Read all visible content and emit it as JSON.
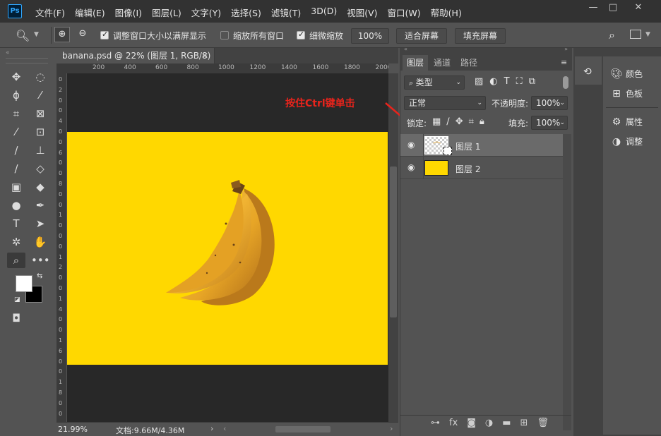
{
  "app": {
    "logo_text": "Ps"
  },
  "menu": [
    "文件(F)",
    "编辑(E)",
    "图像(I)",
    "图层(L)",
    "文字(Y)",
    "选择(S)",
    "滤镜(T)",
    "3D(D)",
    "视图(V)",
    "窗口(W)",
    "帮助(H)"
  ],
  "window_controls": {
    "minimize": "—",
    "maximize": "□",
    "close": "✕"
  },
  "options_bar": {
    "resize_windows_label": "调整窗口大小以满屏显示",
    "zoom_all_label": "缩放所有窗口",
    "scrubby_label": "细微缩放",
    "zoom_value": "100%",
    "fit_screen": "适合屏幕",
    "fill_screen": "填充屏幕"
  },
  "document": {
    "tab_title": "banana.psd @ 22% (图层 1, RGB/8)",
    "ruler_h": [
      "200",
      "400",
      "600",
      "800",
      "1000",
      "1200",
      "1400",
      "1600",
      "1800",
      "2000"
    ],
    "ruler_v": [
      "0",
      "2",
      "0",
      "0",
      "4",
      "0",
      "0",
      "6",
      "0",
      "0",
      "8",
      "0",
      "0",
      "1",
      "0",
      "0",
      "0",
      "1",
      "2",
      "0",
      "0",
      "1",
      "4",
      "0",
      "0",
      "1",
      "6",
      "0",
      "0",
      "1",
      "8",
      "0",
      "0"
    ],
    "zoom_status": "21.99%",
    "doc_size": "文档:9.66M/4.36M"
  },
  "annotation": {
    "text": "按住Ctrl键单击",
    "color": "#e8241c"
  },
  "layers_panel": {
    "tabs": [
      "图层",
      "通道",
      "路径"
    ],
    "filter_type": "类型",
    "blend_mode": "正常",
    "opacity_label": "不透明度:",
    "opacity_value": "100%",
    "lock_label": "锁定:",
    "fill_label": "填充:",
    "fill_value": "100%",
    "layers": [
      {
        "name": "图层 1",
        "selected": true
      },
      {
        "name": "图层 2",
        "selected": false
      }
    ]
  },
  "right_dock": {
    "items": [
      "颜色",
      "色板",
      "属性",
      "调整"
    ]
  },
  "colors": {
    "canvas_yellow": "#ffd800",
    "foreground": "#ffffff",
    "background": "#000000"
  }
}
